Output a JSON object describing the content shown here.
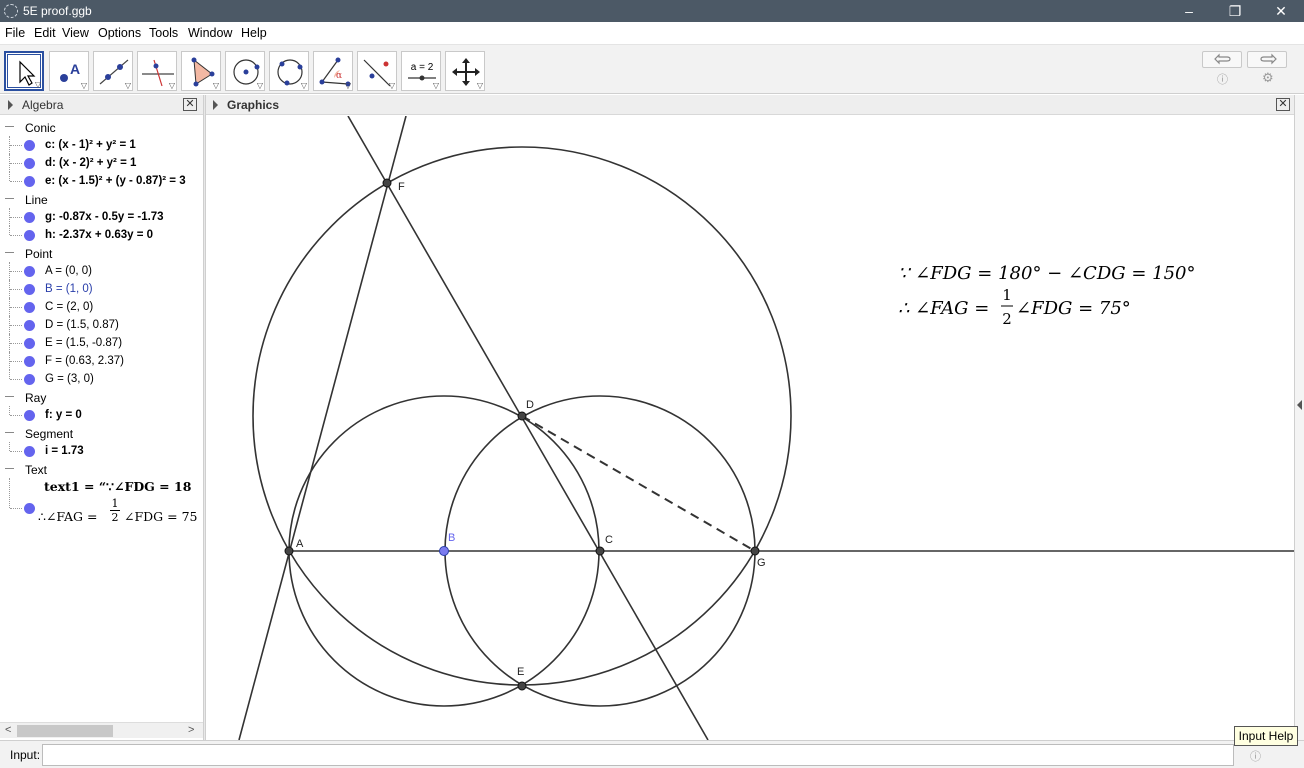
{
  "window": {
    "title": "5E proof.ggb"
  },
  "menu": [
    "File",
    "Edit",
    "View",
    "Options",
    "Tools",
    "Window",
    "Help"
  ],
  "toolbar": {
    "tools": [
      {
        "name": "move",
        "icon": "move-arrow-icon"
      },
      {
        "name": "point",
        "icon": "point-icon"
      },
      {
        "name": "line",
        "icon": "line-icon"
      },
      {
        "name": "perpendicular",
        "icon": "perpendicular-icon"
      },
      {
        "name": "polygon",
        "icon": "polygon-icon"
      },
      {
        "name": "circle",
        "icon": "circle-center-icon"
      },
      {
        "name": "conic",
        "icon": "circle-three-points-icon"
      },
      {
        "name": "angle",
        "icon": "angle-icon"
      },
      {
        "name": "reflect",
        "icon": "reflect-icon"
      },
      {
        "name": "slider",
        "icon": "slider-icon",
        "label": "a = 2"
      },
      {
        "name": "move-view",
        "icon": "move-view-icon"
      }
    ]
  },
  "panels": {
    "algebra": "Algebra",
    "graphics": "Graphics"
  },
  "algebra": {
    "categories": [
      {
        "label": "Conic",
        "items": [
          "c: (x - 1)² + y² = 1",
          "d: (x - 2)² + y² = 1",
          "e: (x - 1.5)² + (y - 0.87)² = 3"
        ]
      },
      {
        "label": "Line",
        "items": [
          "g: -0.87x - 0.5y = -1.73",
          "h: -2.37x + 0.63y = 0"
        ]
      },
      {
        "label": "Point",
        "items": [
          "A = (0, 0)",
          "B = (1, 0)",
          "C = (2, 0)",
          "D = (1.5, 0.87)",
          "E = (1.5, -0.87)",
          "F = (0.63, 2.37)",
          "G = (3, 0)"
        ]
      },
      {
        "label": "Ray",
        "items": [
          "f: y = 0"
        ]
      },
      {
        "label": "Segment",
        "items": [
          "i = 1.73"
        ]
      },
      {
        "label": "Text",
        "items": [
          "text1 = “∵∠FDG = 18",
          "∴∠FAG = ",
          "∠FDG = 75"
        ]
      }
    ],
    "text_fraction": {
      "num": "1",
      "den": "2"
    }
  },
  "graphics": {
    "points": [
      "A",
      "B",
      "C",
      "D",
      "E",
      "F",
      "G"
    ],
    "math_line1": "∵ ∠FDG = 180° − ∠CDG = 150°",
    "math_line2_prefix": "∴ ∠FAG =",
    "math_line2_suffix": "∠FDG = 75°",
    "math_fraction": {
      "num": "1",
      "den": "2"
    }
  },
  "input": {
    "label": "Input:",
    "tooltip": "Input Help",
    "help_icon": "help-icon"
  },
  "colors": {
    "point_fill": "#6464ee",
    "free_point": "#6464ee",
    "object": "#333333",
    "titlebar": "#4c5966"
  }
}
